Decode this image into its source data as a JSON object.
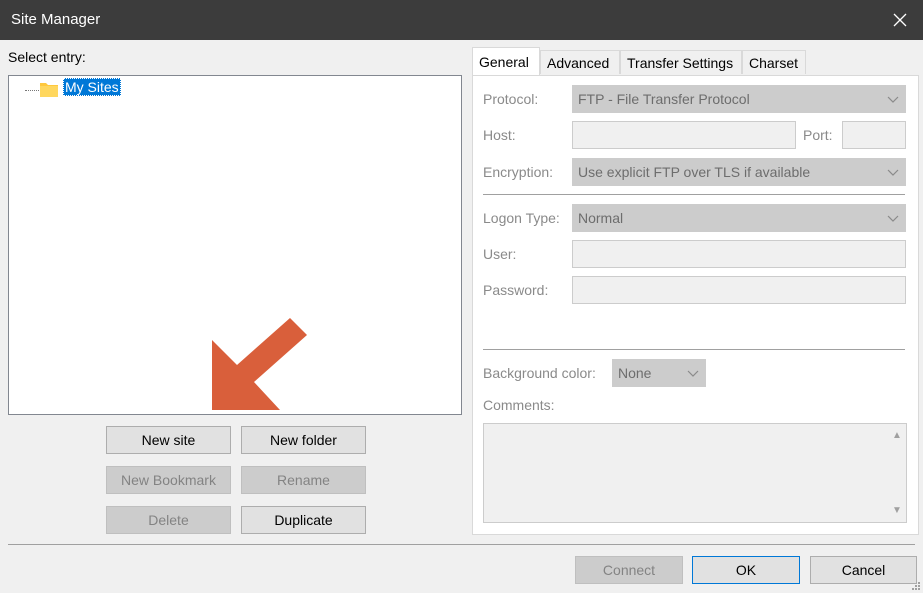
{
  "window": {
    "title": "Site Manager"
  },
  "left": {
    "select_label": "Select entry:",
    "tree": {
      "root_label": "My Sites"
    },
    "buttons": {
      "new_site": "New site",
      "new_folder": "New folder",
      "new_bookmark": "New Bookmark",
      "rename": "Rename",
      "delete": "Delete",
      "duplicate": "Duplicate"
    }
  },
  "tabs": [
    "General",
    "Advanced",
    "Transfer Settings",
    "Charset"
  ],
  "general": {
    "protocol_label": "Protocol:",
    "protocol_value": "FTP - File Transfer Protocol",
    "host_label": "Host:",
    "host_value": "",
    "port_label": "Port:",
    "port_value": "",
    "encryption_label": "Encryption:",
    "encryption_value": "Use explicit FTP over TLS if available",
    "logon_label": "Logon Type:",
    "logon_value": "Normal",
    "user_label": "User:",
    "user_value": "",
    "password_label": "Password:",
    "password_value": "",
    "bgcolor_label": "Background color:",
    "bgcolor_value": "None",
    "comments_label": "Comments:",
    "comments_value": ""
  },
  "footer": {
    "connect": "Connect",
    "ok": "OK",
    "cancel": "Cancel"
  },
  "colors": {
    "titlebar": "#3c3c3c",
    "selection": "#0078d7",
    "annotation_arrow": "#d95f3b",
    "folder": "#ffc83d"
  }
}
